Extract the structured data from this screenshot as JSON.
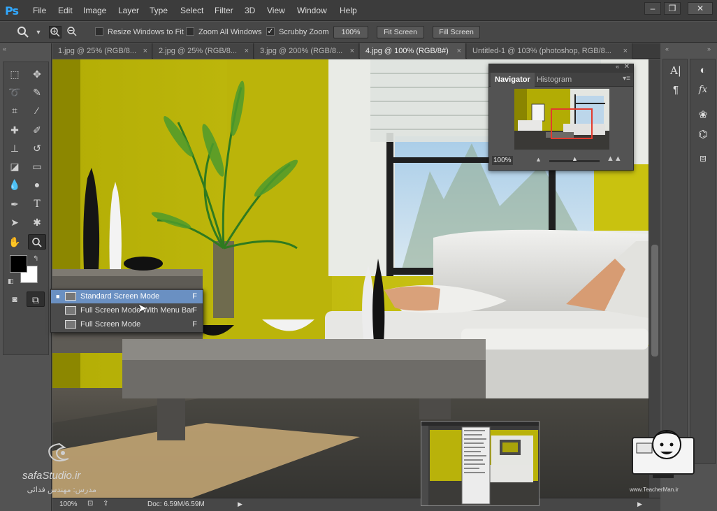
{
  "app": {
    "logo": "Ps"
  },
  "menu": [
    "File",
    "Edit",
    "Image",
    "Layer",
    "Type",
    "Select",
    "Filter",
    "3D",
    "View",
    "Window",
    "Help"
  ],
  "window_buttons": [
    "–",
    "❐",
    "✕"
  ],
  "options": {
    "resize_windows_label": "Resize Windows to Fit",
    "zoom_all_label": "Zoom All Windows",
    "scrubby_label": "Scrubby Zoom",
    "scrubby_checked": true,
    "percent_btn": "100%",
    "fit_screen_btn": "Fit Screen",
    "fill_screen_btn": "Fill Screen"
  },
  "tabs": [
    {
      "label": "1.jpg @ 25% (RGB/8...",
      "active": false
    },
    {
      "label": "2.jpg @ 25% (RGB/8...",
      "active": false
    },
    {
      "label": "3.jpg @ 200% (RGB/8...",
      "active": false
    },
    {
      "label": "4.jpg @ 100% (RGB/8#)",
      "active": true
    },
    {
      "label": "Untitled-1 @ 103% (photoshop, RGB/8...",
      "active": false
    }
  ],
  "navigator": {
    "tab_navigator": "Navigator",
    "tab_histogram": "Histogram",
    "zoom": "100%"
  },
  "screen_mode_menu": [
    {
      "label": "Standard Screen Mode",
      "key": "F",
      "selected": true
    },
    {
      "label": "Full Screen Mode With Menu Bar",
      "key": "F",
      "selected": false
    },
    {
      "label": "Full Screen Mode",
      "key": "F",
      "selected": false
    }
  ],
  "status": {
    "zoom": "100%",
    "doc": "Doc: 6.59M/6.59M"
  },
  "watermark": {
    "brand": "safaStudio.ir",
    "teacher_line": "مدرس: مهندس فدائی"
  },
  "teacher_badge": {
    "site": "www.TeacherMan.ir"
  }
}
